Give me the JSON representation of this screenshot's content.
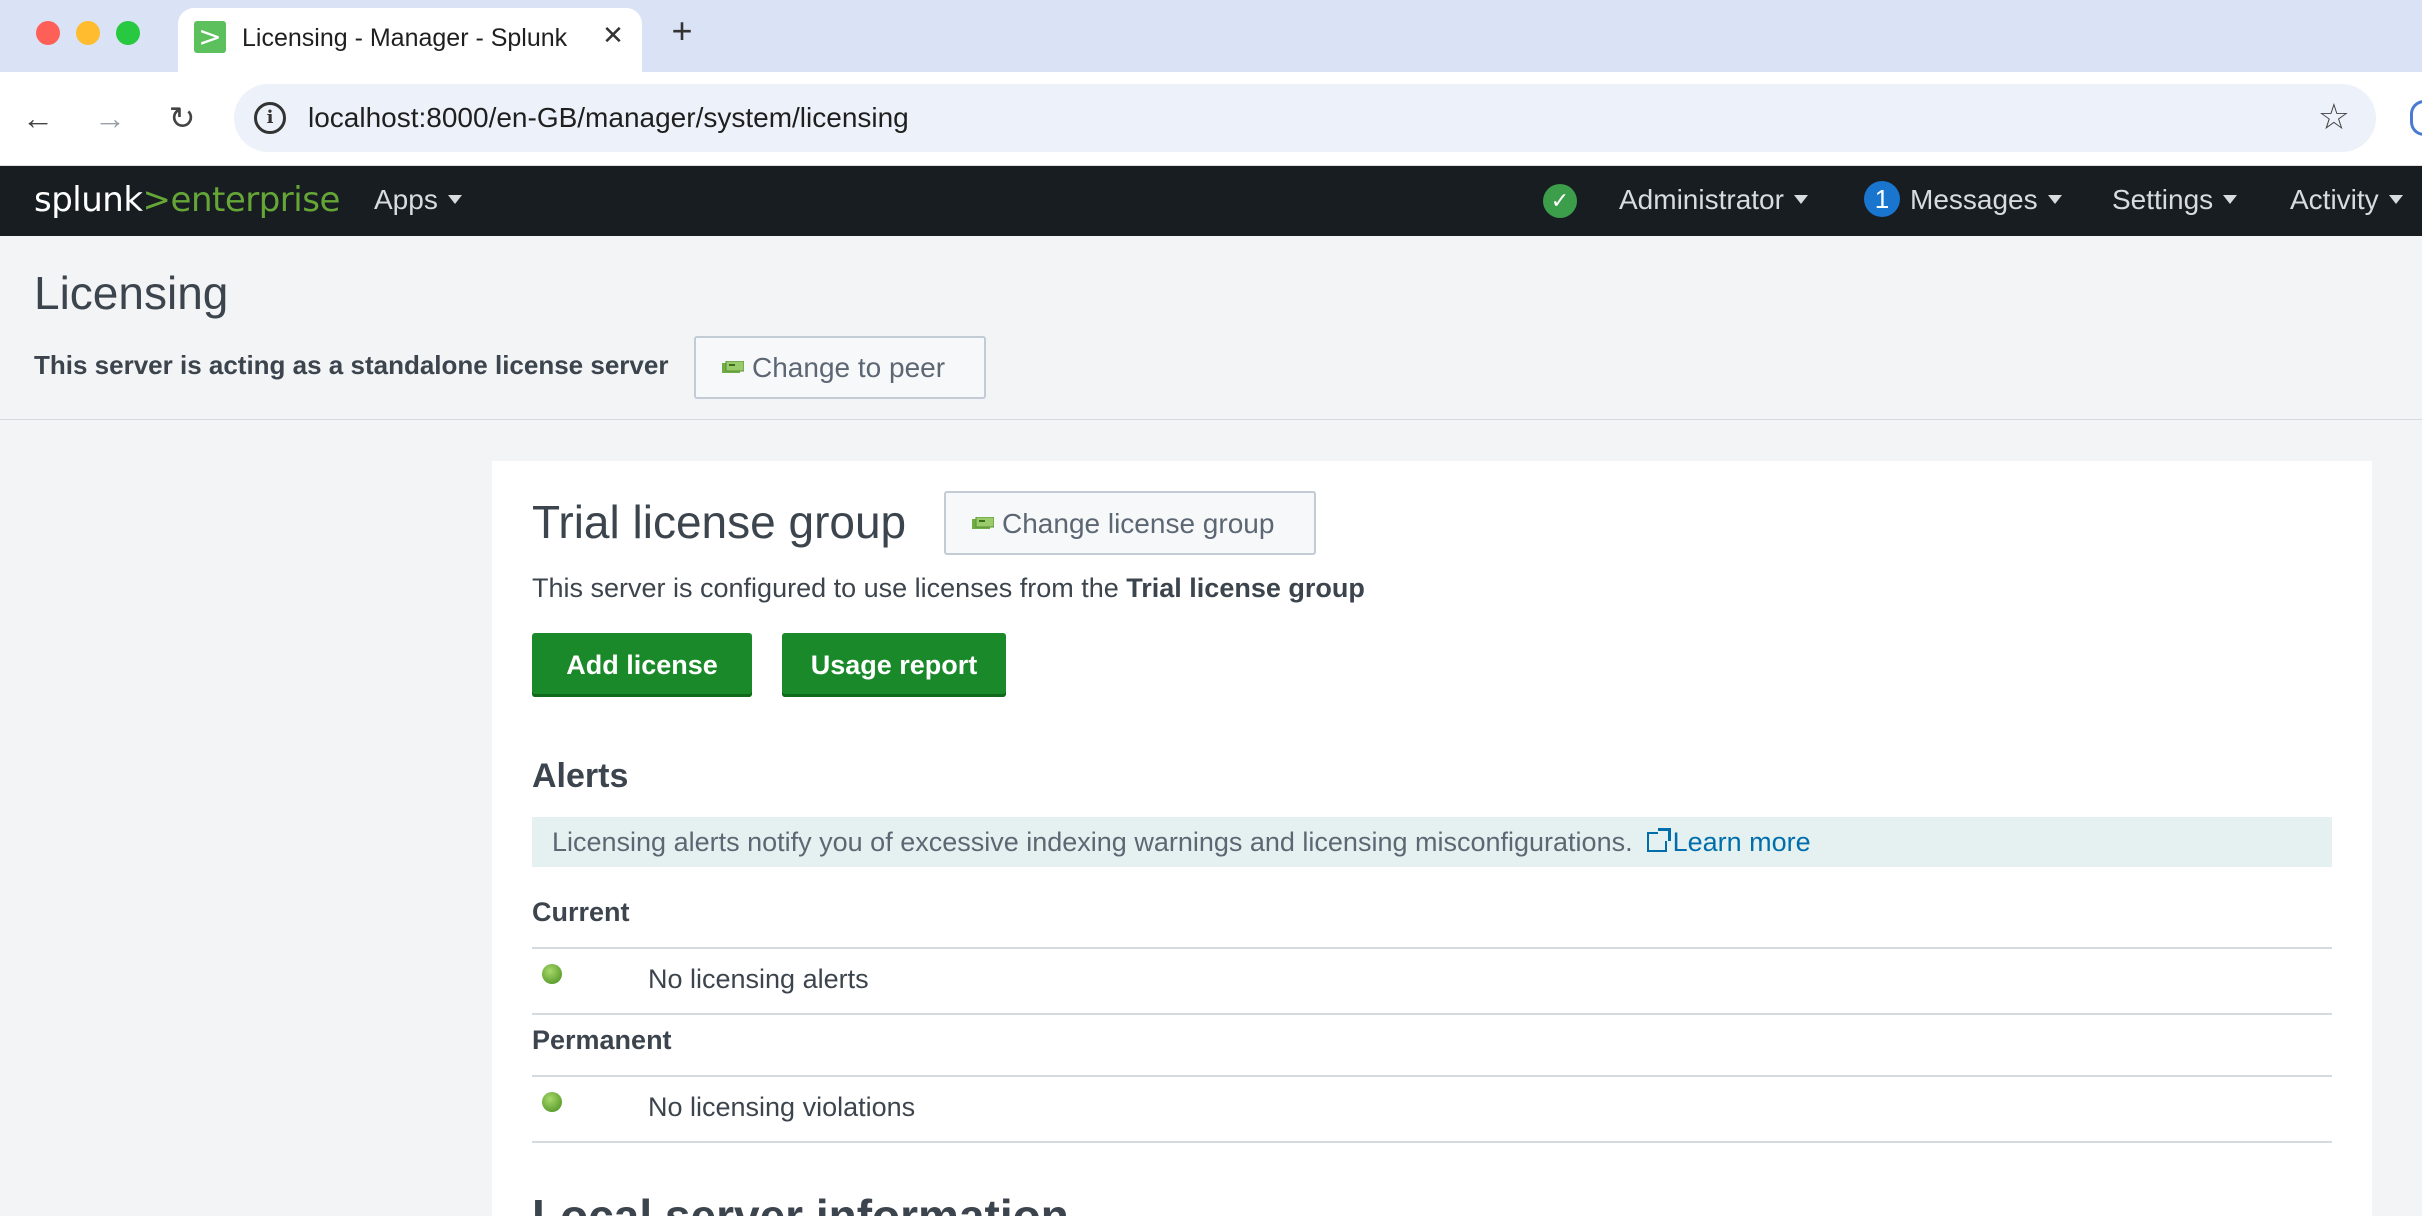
{
  "browser": {
    "tab_title": "Licensing - Manager - Splunk",
    "url": "localhost:8000/en-GB/manager/system/licensing",
    "favicon_glyph": ">",
    "close_glyph": "✕",
    "new_tab_glyph": "+",
    "back_glyph": "←",
    "forward_glyph": "→",
    "reload_glyph": "↻",
    "info_glyph": "i",
    "star_glyph": "☆"
  },
  "splunkbar": {
    "logo_word": "splunk",
    "logo_chevron": ">",
    "logo_product": "enterprise",
    "apps_label": "Apps",
    "health_glyph": "✓",
    "user_label": "Administrator",
    "messages_count": "1",
    "messages_label": "Messages",
    "settings_label": "Settings",
    "activity_label": "Activity"
  },
  "header": {
    "title": "Licensing",
    "server_mode": "This server is acting as a standalone license server",
    "change_to_peer_label": "Change to peer"
  },
  "license_group": {
    "title": "Trial license group",
    "change_group_label": "Change license group",
    "config_prefix": "This server is configured to use licenses from the ",
    "config_group": "Trial license group",
    "add_license_label": "Add license",
    "usage_report_label": "Usage report"
  },
  "alerts": {
    "title": "Alerts",
    "info_text": "Licensing alerts notify you of excessive indexing warnings and licensing misconfigurations.",
    "learn_more_label": "Learn more",
    "current_label": "Current",
    "current_status": "No licensing alerts",
    "permanent_label": "Permanent",
    "permanent_status": "No licensing violations"
  },
  "local_server": {
    "title": "Local server information"
  },
  "colors": {
    "splunkbar_bg": "#171d21",
    "brand_green": "#65a637",
    "primary_button": "#1a8929",
    "info_banner_bg": "#e5f1f1",
    "link_blue": "#006eaa",
    "message_badge": "#1a75cf"
  }
}
